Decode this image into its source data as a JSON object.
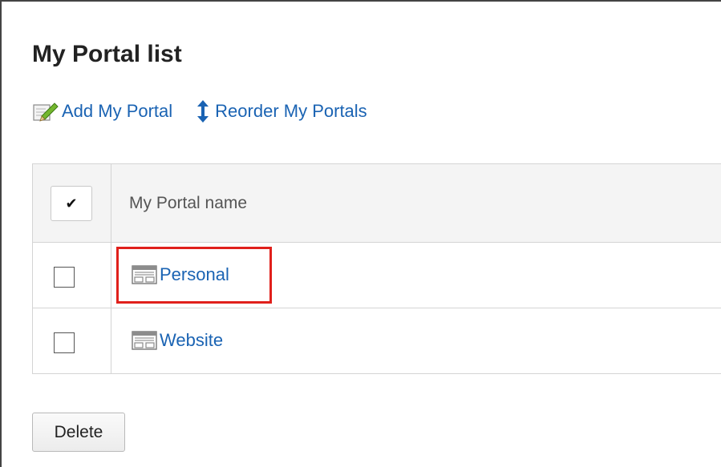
{
  "page": {
    "title": "My Portal list"
  },
  "actions": {
    "add_label": "Add My Portal",
    "add_icon": "edit-pencil-icon",
    "reorder_label": "Reorder My Portals",
    "reorder_icon": "updown-arrow-icon"
  },
  "table": {
    "header_check": "✔",
    "header_label": "My Portal name",
    "rows": [
      {
        "name": "Personal",
        "icon": "portal-layout-icon",
        "checked": false,
        "highlighted": true
      },
      {
        "name": "Website",
        "icon": "portal-layout-icon",
        "checked": false,
        "highlighted": false
      }
    ]
  },
  "footer": {
    "delete_label": "Delete"
  },
  "colors": {
    "link": "#1a63b3",
    "highlight": "#e0201b",
    "header_bg": "#f4f4f4",
    "border": "#d4d4d4"
  }
}
